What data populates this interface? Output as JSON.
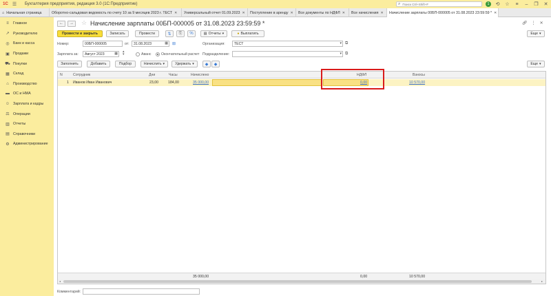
{
  "app": {
    "logo": "1С",
    "title": "Бухгалтерия предприятия, редакция 3.0  (1С:Предприятие)",
    "search_placeholder": "Поиск Ctrl+Shift+F",
    "notification_count": "1"
  },
  "tabs": [
    {
      "label": "Начальная страница"
    },
    {
      "label": "Оборотно-сальдовая ведомость по счету 10 за 9 месяцев 2023 г. ТЕСТ"
    },
    {
      "label": "Универсальный отчет 01.09.2023"
    },
    {
      "label": "Поступление в аренду"
    },
    {
      "label": "Все документы по НДФЛ"
    },
    {
      "label": "Все начисления"
    },
    {
      "label": "Начисление зарплаты 00БП-000005 от 31.08.2023 23:59:59 *"
    }
  ],
  "sidebar": {
    "items": [
      {
        "label": "Главное"
      },
      {
        "label": "Руководителю"
      },
      {
        "label": "Банк и касса"
      },
      {
        "label": "Продажи"
      },
      {
        "label": "Покупки"
      },
      {
        "label": "Склад"
      },
      {
        "label": "Производство"
      },
      {
        "label": "ОС и НМА"
      },
      {
        "label": "Зарплата и кадры"
      },
      {
        "label": "Операции"
      },
      {
        "label": "Отчеты"
      },
      {
        "label": "Справочники"
      },
      {
        "label": "Администрирование"
      }
    ]
  },
  "document": {
    "title": "Начисление зарплаты 00БП-000005 от 31.08.2023 23:59:59 *"
  },
  "toolbar": {
    "post_close": "Провести и закрыть",
    "save": "Записать",
    "post": "Провести",
    "reports": "Отчеты",
    "pay": "Выплатить",
    "more": "Еще"
  },
  "form": {
    "number_label": "Номер:",
    "number_value": "00БП-000005",
    "date_label": "от:",
    "date_value": "31.08.2023",
    "org_label": "Организация:",
    "org_value": "ТЕСТ",
    "salary_for_label": "Зарплата за:",
    "salary_for_value": "Август 2023",
    "advance_label": "Аванс",
    "final_label": "Окончательный расчет",
    "dept_label": "Подразделение:",
    "dept_value": ""
  },
  "table_toolbar": {
    "fill": "Заполнить",
    "add": "Добавить",
    "pick": "Подбор",
    "accrue": "Начислить",
    "deduct": "Удержать",
    "more": "Еще"
  },
  "table": {
    "headers": {
      "n": "N",
      "employee": "Сотрудник",
      "days": "Дни",
      "hours": "Часы",
      "accrued": "Начислено",
      "ndfl": "НДФЛ",
      "contrib": "Взносы"
    },
    "rows": [
      {
        "n": "1",
        "employee": "Иванов Иван Иванович",
        "days": "23,00",
        "hours": "184,00",
        "accrued": "35 000,00",
        "ndfl": "0,00",
        "contrib": "10 570,00"
      }
    ],
    "totals": {
      "accrued": "35 000,00",
      "ndfl": "0,00",
      "contrib": "10 570,00"
    }
  },
  "comment": {
    "label": "Комментарий:",
    "value": ""
  }
}
